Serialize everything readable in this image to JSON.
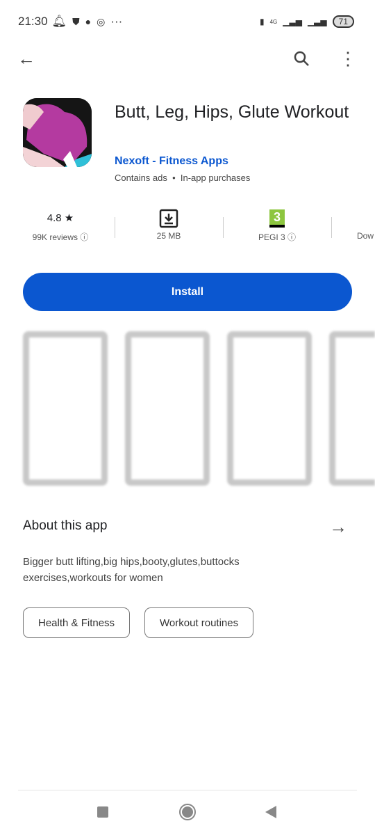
{
  "status_bar": {
    "time": "21:30",
    "battery": "71",
    "network": "4G"
  },
  "app": {
    "title": "Butt, Leg, Hips, Glute Workout",
    "developer": "Nexoft - Fitness Apps",
    "meta": "Contains ads  •  In-app purchases"
  },
  "stats": [
    {
      "top": "4.8 ★",
      "bottom": "99K reviews ⓘ"
    },
    {
      "top": "",
      "bottom": "25 MB"
    },
    {
      "top": "3",
      "bottom": "PEGI 3 ⓘ"
    },
    {
      "top": "",
      "bottom": "Dow"
    }
  ],
  "install_label": "Install",
  "about": {
    "title": "About this app",
    "description": "Bigger butt lifting,big hips,booty,glutes,buttocks exercises,workouts for women"
  },
  "chips": [
    "Health & Fitness",
    "Workout routines"
  ],
  "colors": {
    "accent": "#0b57d0",
    "pegi": "#8dc63f"
  }
}
